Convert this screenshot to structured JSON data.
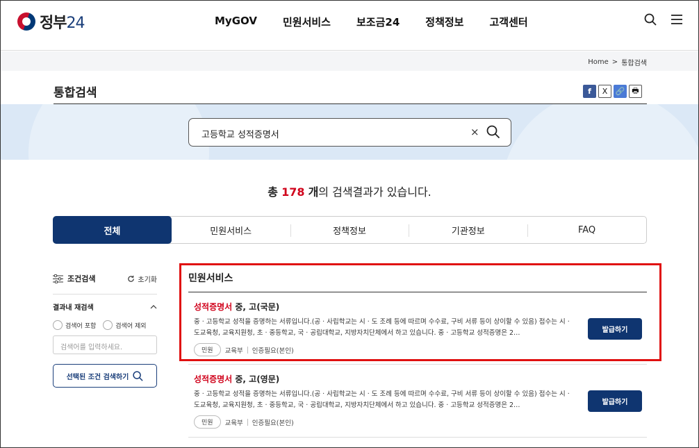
{
  "header": {
    "logo_text": "정부",
    "logo_num": "24",
    "nav": [
      "MyGOV",
      "민원서비스",
      "보조금24",
      "정책정보",
      "고객센터"
    ]
  },
  "breadcrumb": {
    "home": "Home",
    "sep": ">",
    "current": "통합검색"
  },
  "page_title": "통합검색",
  "share": {
    "facebook": "f",
    "x": "X",
    "link": "🔗",
    "print": "🖶"
  },
  "search": {
    "value": "고등학교 성적증명서",
    "clear": "×"
  },
  "result_count": {
    "prefix": "총",
    "number": "178",
    "unit": "개",
    "suffix": "의 검색결과가 있습니다."
  },
  "tabs": [
    {
      "label": "전체",
      "active": true
    },
    {
      "label": "민원서비스",
      "active": false
    },
    {
      "label": "정책정보",
      "active": false
    },
    {
      "label": "기관정보",
      "active": false
    },
    {
      "label": "FAQ",
      "active": false
    }
  ],
  "filter": {
    "title": "조건검색",
    "reset": "초기화",
    "refine_title": "결과내 재검색",
    "include": "검색어 포함",
    "exclude": "검색어 제외",
    "placeholder": "검색어를 입력하세요.",
    "apply": "선택된 조건 검색하기"
  },
  "section_title": "민원서비스",
  "results": [
    {
      "title_em": "성적증명서",
      "title_rest": " 중, 고(국문)",
      "desc": "중 · 고등학교 성적을 증명하는 서류입니다.(공 · 사립학교는 시 · 도 조례 등에 따르며 수수료, 구비 서류 등이 상이할 수 있음) 접수는 시 · 도교육청, 교육지원청, 초 · 중등학교, 국 · 공립대학교, 지방자치단체에서 하고 있습니다. 중 · 고등학교 성적증명은 2…",
      "chip": "민원",
      "org": "교육부",
      "auth": "인증필요(본인)",
      "button": "발급하기"
    },
    {
      "title_em": "성적증명서",
      "title_rest": " 중, 고(영문)",
      "desc": "중 · 고등학교 성적을 증명하는 서류입니다.(공 · 사립학교는 시 · 도 조례 등에 따르며 수수료, 구비 서류 등이 상이할 수 있음) 접수는 시 · 도교육청, 교육지원청, 초 · 중등학교, 국 · 공립대학교, 지방자치단체에서 하고 있습니다. 중 · 고등학교 성적증명은 2…",
      "chip": "민원",
      "org": "교육부",
      "auth": "인증필요(본인)",
      "button": "발급하기"
    }
  ],
  "colors": {
    "brand_navy": "#0f3570",
    "highlight_red": "#d0021b",
    "band_blue": "#dbe8f6"
  }
}
